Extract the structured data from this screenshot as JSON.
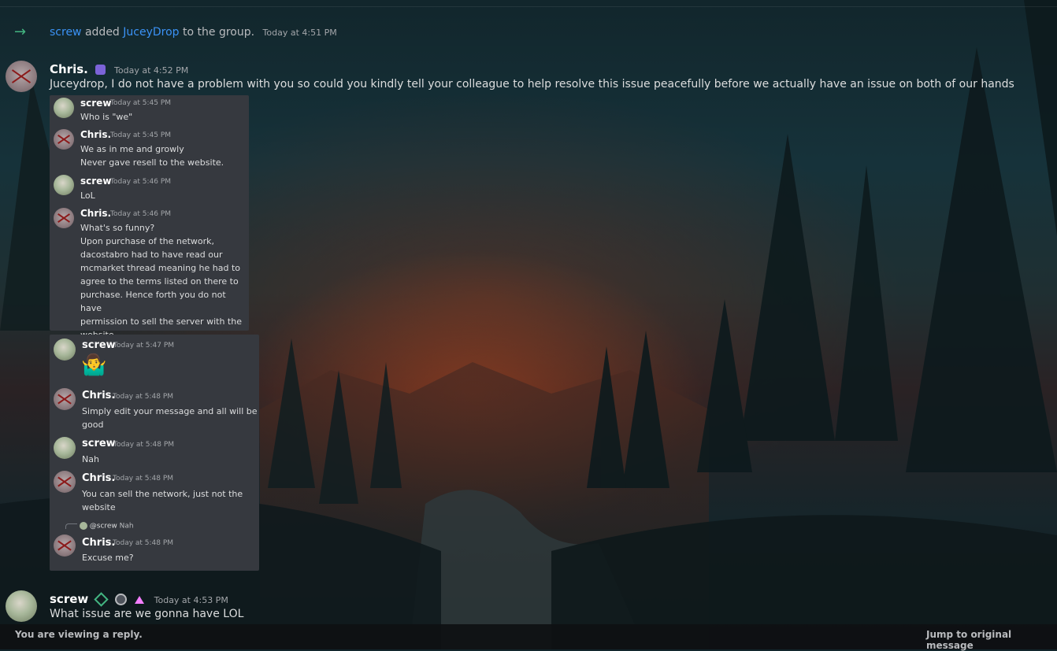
{
  "colors": {
    "link": "#3b92f5",
    "arrow": "#43b581",
    "nitro_badge": "#7c63d8",
    "verified_badge": "#43b581",
    "panel_bg": "#36393f"
  },
  "system_message": {
    "actor": "screw",
    "verb": "added",
    "target": "JuceyDrop",
    "suffix": "to the group.",
    "timestamp": "Today at 4:51 PM"
  },
  "main_message": {
    "author": "Chris.",
    "timestamp": "Today at 4:52 PM",
    "text": "Juceydrop, I do not have a problem with you so could you kindly tell your colleague to help resolve this issue peacefully before we actually have an issue on both of our hands"
  },
  "panel1": [
    {
      "author": "screw",
      "timestamp": "Today at 5:45 PM",
      "lines": [
        "Who is \"we\""
      ]
    },
    {
      "author": "Chris.",
      "timestamp": "Today at 5:45 PM",
      "lines": [
        "We as in me and growly",
        "Never gave resell to the website."
      ]
    },
    {
      "author": "screw",
      "timestamp": "Today at 5:46 PM",
      "lines": [
        "LoL"
      ]
    },
    {
      "author": "Chris.",
      "timestamp": "Today at 5:46 PM",
      "lines": [
        "What's so funny?",
        "Upon purchase of the network,",
        "dacostabro had to have read our",
        "mcmarket thread meaning he had to",
        "agree to the terms listed on there to",
        "purchase. Hence forth you do not have",
        "permission to sell the server with the",
        "website."
      ]
    }
  ],
  "panel2": {
    "messages": [
      {
        "author": "screw",
        "timestamp": "Today at 5:47 PM",
        "emoji": "🤷‍♂️"
      },
      {
        "author": "Chris.",
        "timestamp": "Today at 5:48 PM",
        "lines": [
          "Simply edit your message and all will be",
          "good"
        ]
      },
      {
        "author": "screw",
        "timestamp": "Today at 5:48 PM",
        "lines": [
          "Nah"
        ]
      },
      {
        "author": "Chris.",
        "timestamp": "Today at 5:48 PM",
        "lines": [
          "You can sell the network, just not the",
          "website"
        ]
      }
    ],
    "reply_ref": {
      "mention": "@screw",
      "text": "Nah"
    },
    "last": {
      "author": "Chris.",
      "timestamp": "Today at 5:48 PM",
      "text": "Excuse me?"
    }
  },
  "reply_message": {
    "author": "screw",
    "timestamp": "Today at 4:53 PM",
    "text": "What issue are we gonna have LOL"
  },
  "bottom_bar": {
    "left_text": "You are viewing a reply.",
    "right_text": "Jump to original message"
  }
}
